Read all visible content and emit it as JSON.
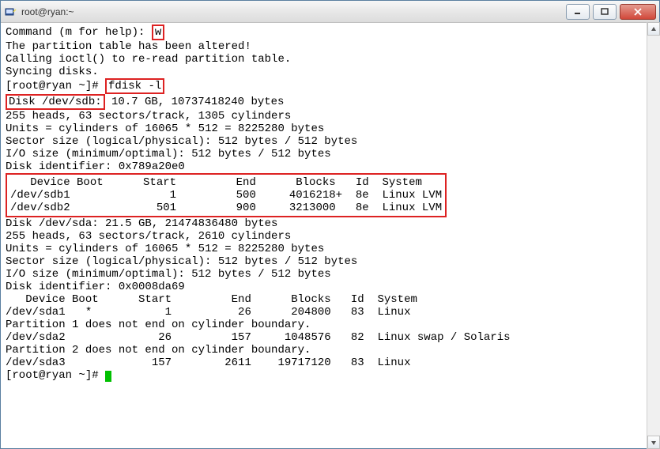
{
  "window": {
    "title": "root@ryan:~"
  },
  "terminal": {
    "cmd_prompt_label": "Command (m for help): ",
    "cmd_w": "w",
    "altered_msg": "The partition table has been altered!",
    "blank": "",
    "ioctl_msg": "Calling ioctl() to re-read partition table.",
    "sync_msg": "Syncing disks.",
    "prompt1": "[root@ryan ~]# ",
    "fdisk_cmd": "fdisk -l",
    "disk_sdb_label": "Disk /dev/sdb:",
    "disk_sdb_rest": " 10.7 GB, 10737418240 bytes",
    "sdb_geo": "255 heads, 63 sectors/track, 1305 cylinders",
    "sdb_units": "Units = cylinders of 16065 * 512 = 8225280 bytes",
    "sdb_sector": "Sector size (logical/physical): 512 bytes / 512 bytes",
    "sdb_io": "I/O size (minimum/optimal): 512 bytes / 512 bytes",
    "sdb_id": "Disk identifier: 0x789a20e0",
    "sdb_header": "   Device Boot      Start         End      Blocks   Id  System",
    "sdb_row1": "/dev/sdb1               1         500     4016218+  8e  Linux LVM",
    "sdb_row2": "/dev/sdb2             501         900     3213000   8e  Linux LVM",
    "disk_sda": "Disk /dev/sda: 21.5 GB, 21474836480 bytes",
    "sda_geo": "255 heads, 63 sectors/track, 2610 cylinders",
    "sda_units": "Units = cylinders of 16065 * 512 = 8225280 bytes",
    "sda_sector": "Sector size (logical/physical): 512 bytes / 512 bytes",
    "sda_io": "I/O size (minimum/optimal): 512 bytes / 512 bytes",
    "sda_id": "Disk identifier: 0x0008da69",
    "sda_header": "   Device Boot      Start         End      Blocks   Id  System",
    "sda_row1": "/dev/sda1   *           1          26      204800   83  Linux",
    "sda_warn1": "Partition 1 does not end on cylinder boundary.",
    "sda_row2": "/dev/sda2              26         157     1048576   82  Linux swap / Solaris",
    "sda_warn2": "Partition 2 does not end on cylinder boundary.",
    "sda_row3": "/dev/sda3             157        2611    19717120   83  Linux",
    "prompt2": "[root@ryan ~]# "
  }
}
